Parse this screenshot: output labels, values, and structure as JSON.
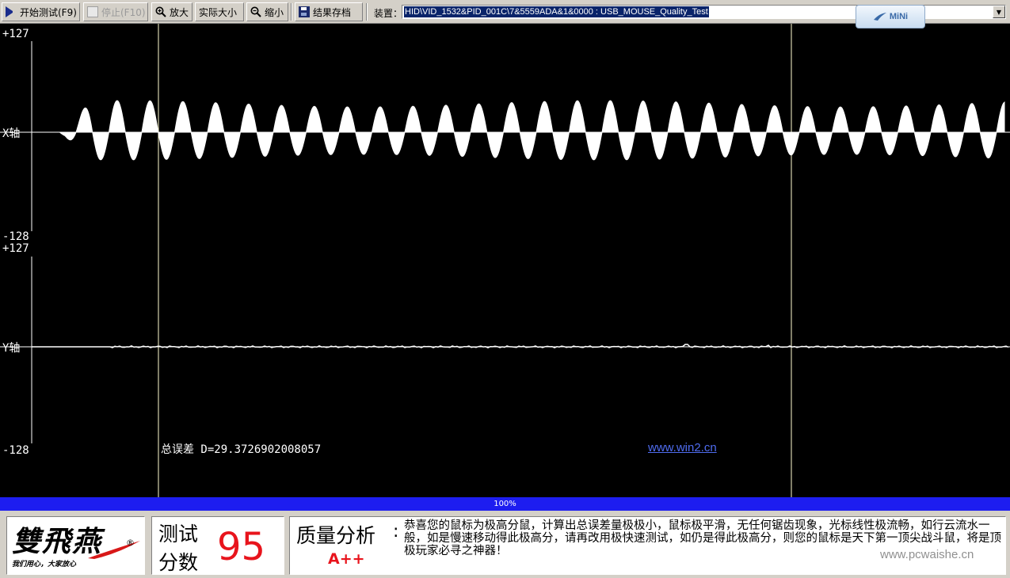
{
  "toolbar": {
    "start_label": "开始测试(F9)",
    "stop_label": "停止(F10)",
    "zoom_in_label": "放大",
    "actual_size_label": "实际大小",
    "zoom_out_label": "缩小",
    "save_label": "结果存档",
    "device_label": "装置：",
    "device_value": "HID\\VID_1532&PID_001C\\7&5559ADA&1&0000 : USB_MOUSE_Quality_Test",
    "mini_label": "MiNi"
  },
  "plot": {
    "x_channel": {
      "label": "X轴",
      "max_label": "+127",
      "min_label": "-128"
    },
    "y_channel": {
      "label": "Y轴",
      "max_label": "+127",
      "min_label": "-128"
    },
    "error_text": "总误差 D=29.3726902008057",
    "site_link": "www.win2.cn"
  },
  "progress": {
    "label": "100%",
    "value": 1.0
  },
  "logo": {
    "text": "雙飛燕",
    "slogan": "我们用心，大家放心",
    "reg": "®"
  },
  "score": {
    "label_line1": "测试",
    "label_line2": "分数",
    "value": "95"
  },
  "analysis": {
    "title": "质量分析",
    "colon": ":",
    "grade": "A++",
    "text": "恭喜您的鼠标为极高分鼠，计算出总误差量极极小，鼠标极平滑，无任何锯齿现象，光标线性极流畅，如行云流水一般，如是慢速移动得此极高分，请再改用极快速测试，如仍是得此极高分，则您的鼠标是天下第一顶尖战斗鼠，将是顶极玩家必寻之神器！"
  },
  "watermark": {
    "text": "www.pcwaishe.cn"
  },
  "colors": {
    "plot_bg": "#000000",
    "trace": "#ffffff",
    "score_red": "#e8141c",
    "progress_blue": "#1d1df0",
    "link_blue": "#4f6cf0"
  }
}
